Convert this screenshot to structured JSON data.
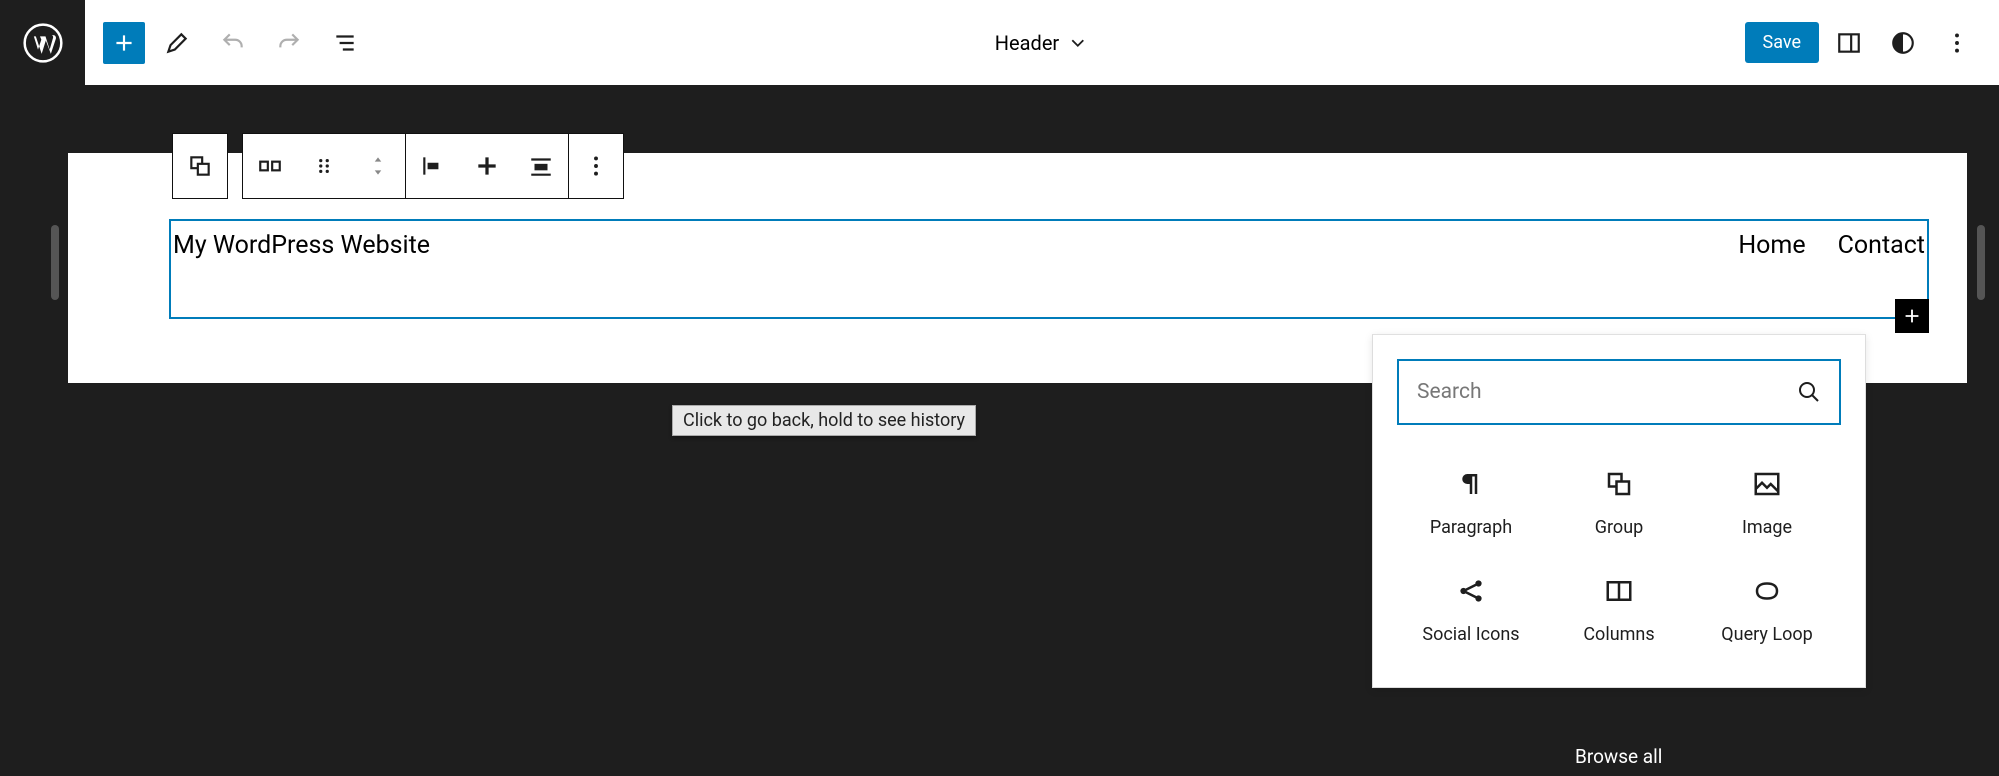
{
  "topbar": {
    "template_label": "Header",
    "save_label": "Save"
  },
  "canvas": {
    "site_title": "My WordPress Website",
    "nav": {
      "home": "Home",
      "contact": "Contact"
    }
  },
  "tooltip": {
    "text": "Click to go back, hold to see history"
  },
  "inserter": {
    "search_placeholder": "Search",
    "blocks": {
      "paragraph": "Paragraph",
      "group": "Group",
      "image": "Image",
      "social_icons": "Social Icons",
      "columns": "Columns",
      "query_loop": "Query Loop"
    },
    "browse_all": "Browse all"
  }
}
